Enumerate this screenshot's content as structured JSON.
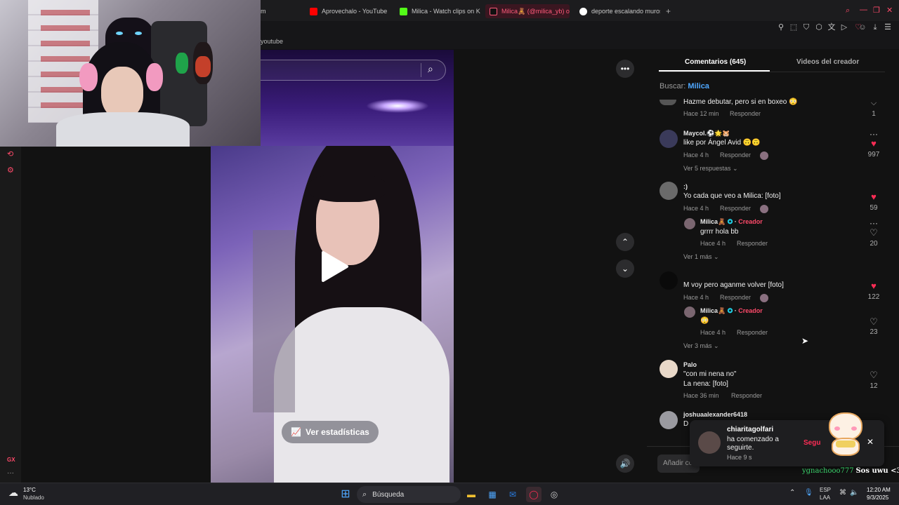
{
  "browser": {
    "tabs": [
      {
        "label": "am",
        "icon": "generic-favicon"
      },
      {
        "label": "Aprovechalo - YouTube",
        "icon": "youtube-icon"
      },
      {
        "label": "Milica - Watch clips on Ki",
        "icon": "kick-icon"
      },
      {
        "label": "Milica🧸 (@milica_yb) o",
        "icon": "tiktok-icon"
      },
      {
        "label": "deporte escalando muros",
        "icon": "google-icon"
      }
    ],
    "new_tab": "+",
    "bookmark": "youtube"
  },
  "video": {
    "more_label": "•••",
    "stats_label": "Ver estadísticas"
  },
  "panel": {
    "tab_comments": "Comentarios (645)",
    "tab_creator_videos": "Videos del creador",
    "search_prefix": "Buscar:",
    "search_term": "Milica",
    "add_comment_placeholder": "Añadir co"
  },
  "comments": [
    {
      "user": "",
      "text": "Hazme debutar, pero si en boxeo 😳",
      "time": "Hace 12 min",
      "reply": "Responder",
      "likes": "1",
      "liked": false
    },
    {
      "user": "Maycol.⚽🌟🐹",
      "text": "like por Ángel Avid 🙃🙃",
      "time": "Hace 4 h",
      "reply": "Responder",
      "likes": "997",
      "liked": true,
      "more": "Ver 5 respuestas"
    },
    {
      "user": ":)",
      "text": "Yo cada que veo a Milica: [foto]",
      "time": "Hace 4 h",
      "reply": "Responder",
      "likes": "59",
      "liked": true
    },
    {
      "user": "Milica🧸",
      "creator_tag": "Creador",
      "text": "grrrr hola bb",
      "time": "Hace 4 h",
      "reply": "Responder",
      "likes": "20",
      "liked": false,
      "more": "Ver 1 más"
    },
    {
      "user": "",
      "text": "M voy pero aganme volver [foto]",
      "time": "Hace 4 h",
      "reply": "Responder",
      "likes": "122",
      "liked": true
    },
    {
      "user": "Milica🧸",
      "creator_tag": "Creador",
      "text": "😳",
      "time": "Hace 4 h",
      "reply": "Responder",
      "likes": "23",
      "liked": false,
      "more": "Ver 3 más"
    },
    {
      "user": "Palo",
      "text": "\"con mi nena no\"",
      "text2": "La nena: [foto]",
      "time": "Hace 36 min",
      "reply": "Responder",
      "likes": "12",
      "liked": false
    },
    {
      "user": "joshuaalexander6418",
      "text": "D",
      "time": "",
      "reply": "",
      "likes": "",
      "liked": false
    }
  ],
  "popup": {
    "user": "chiaritagolfari",
    "message": "ha comenzado a seguirte.",
    "time": "Hace 9 s",
    "action": "Segu",
    "close": "✕"
  },
  "overlay": {
    "user": "ygnachooo777",
    "message": "Sos uwu <3"
  },
  "taskbar": {
    "weather_temp": "13°C",
    "weather_text": "Nublado",
    "search": "Búsqueda",
    "lang1": "ESP",
    "lang2": "LAA",
    "time": "12:20 AM",
    "date": "9/3/2025"
  },
  "left_label": "GX",
  "colors": {
    "accent": "#ff2d55",
    "creator": "#ff4a6a",
    "like": "#fe2c55"
  }
}
